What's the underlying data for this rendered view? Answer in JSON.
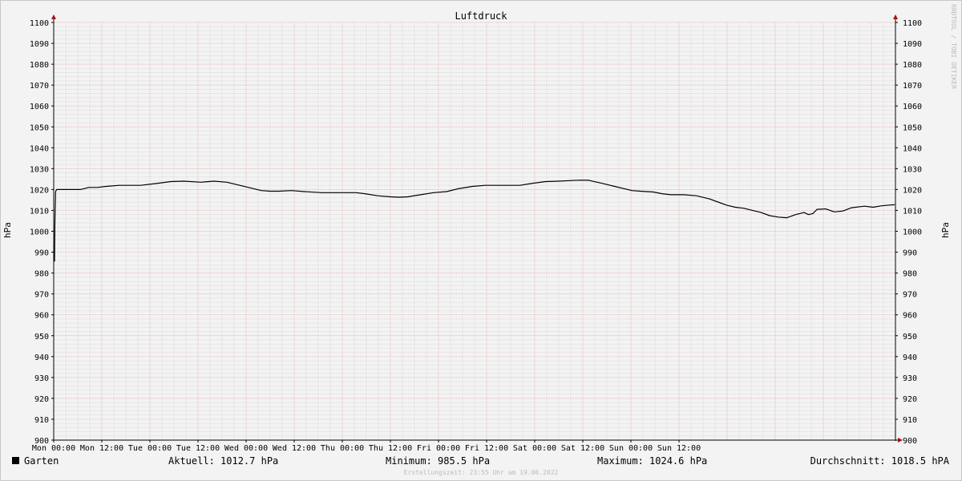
{
  "chart_data": {
    "type": "line",
    "title": "Luftdruck",
    "ylabel": "hPa",
    "ylabel_right": "hPa",
    "ylim": [
      900,
      1100
    ],
    "y_ticks": [
      900,
      910,
      920,
      930,
      940,
      950,
      960,
      970,
      980,
      990,
      1000,
      1010,
      1020,
      1030,
      1040,
      1050,
      1060,
      1070,
      1080,
      1090,
      1100
    ],
    "x_tick_labels": [
      "Mon 00:00",
      "Mon 12:00",
      "Tue 00:00",
      "Tue 12:00",
      "Wed 00:00",
      "Wed 12:00",
      "Thu 00:00",
      "Thu 12:00",
      "Fri 00:00",
      "Fri 12:00",
      "Sat 00:00",
      "Sat 12:00",
      "Sun 00:00",
      "Sun 12:00"
    ],
    "x_range_hours": [
      0,
      168
    ],
    "grid": true,
    "series": [
      {
        "name": "Garten",
        "color": "#000000",
        "points": [
          [
            0,
            985.5
          ],
          [
            0.1,
            1005
          ],
          [
            0.25,
            1019
          ],
          [
            0.5,
            1020
          ],
          [
            2,
            1020
          ],
          [
            4,
            1020
          ],
          [
            6,
            1020
          ],
          [
            8,
            1021
          ],
          [
            10,
            1021
          ],
          [
            12,
            1021.5
          ],
          [
            15,
            1022
          ],
          [
            18,
            1022
          ],
          [
            20,
            1022
          ],
          [
            24,
            1023
          ],
          [
            27,
            1023.8
          ],
          [
            30,
            1024
          ],
          [
            34,
            1023.5
          ],
          [
            37,
            1024
          ],
          [
            40,
            1023.5
          ],
          [
            43,
            1022
          ],
          [
            46,
            1020.5
          ],
          [
            48,
            1019.5
          ],
          [
            50,
            1019.2
          ],
          [
            52,
            1019.2
          ],
          [
            55,
            1019.5
          ],
          [
            58,
            1019
          ],
          [
            62,
            1018.5
          ],
          [
            66,
            1018.5
          ],
          [
            70,
            1018.5
          ],
          [
            72,
            1018
          ],
          [
            75,
            1017
          ],
          [
            78,
            1016.5
          ],
          [
            80,
            1016.3
          ],
          [
            82,
            1016.5
          ],
          [
            85,
            1017.5
          ],
          [
            88,
            1018.5
          ],
          [
            91,
            1019
          ],
          [
            94,
            1020.5
          ],
          [
            97,
            1021.5
          ],
          [
            100,
            1022
          ],
          [
            104,
            1022
          ],
          [
            108,
            1022
          ],
          [
            111,
            1023
          ],
          [
            114,
            1023.8
          ],
          [
            117,
            1024
          ],
          [
            120,
            1024.3
          ],
          [
            122,
            1024.5
          ],
          [
            124,
            1024.4
          ],
          [
            127,
            1023
          ],
          [
            130,
            1021.5
          ],
          [
            132,
            1020.5
          ],
          [
            134,
            1019.5
          ],
          [
            136,
            1019.2
          ],
          [
            139,
            1018.8
          ],
          [
            141,
            1018
          ],
          [
            143,
            1017.5
          ],
          [
            146,
            1017.5
          ],
          [
            149,
            1017
          ],
          [
            152,
            1015.5
          ],
          [
            154,
            1014
          ],
          [
            156,
            1012.5
          ],
          [
            158,
            1011.5
          ],
          [
            160,
            1011
          ],
          [
            162,
            1010
          ],
          [
            164,
            1009
          ],
          [
            166,
            1007.5
          ],
          [
            168,
            1006.8
          ],
          [
            170,
            1006.5
          ],
          [
            172,
            1008
          ],
          [
            174,
            1009
          ],
          [
            175,
            1008
          ],
          [
            176,
            1008.5
          ],
          [
            177,
            1010.5
          ],
          [
            179,
            1010.7
          ],
          [
            181,
            1009.3
          ],
          [
            183,
            1009.7
          ],
          [
            185,
            1011.3
          ],
          [
            187,
            1011.8
          ],
          [
            188,
            1012
          ],
          [
            190,
            1011.5
          ],
          [
            192,
            1012.2
          ],
          [
            194,
            1012.6
          ],
          [
            195,
            1012.7
          ]
        ]
      }
    ]
  },
  "legend": {
    "swatch_color": "#000000",
    "label": "Garten",
    "aktuell": "Aktuell: 1012.7 hPa",
    "minimum": "Minimum: 985.5 hPa",
    "maximum": "Maximum: 1024.6 hPa",
    "durchschnitt": "Durchschnitt: 1018.5 hPA"
  },
  "footer": "Erstellungszeit: 23:55 Uhr am 19.06.2022",
  "watermark": "RRDTOOL / TOBI OETIKER",
  "colors": {
    "major_grid": "#e8a0a0",
    "minor_grid": "#cccccc",
    "axis": "#000000",
    "arrow": "#aa1111"
  }
}
